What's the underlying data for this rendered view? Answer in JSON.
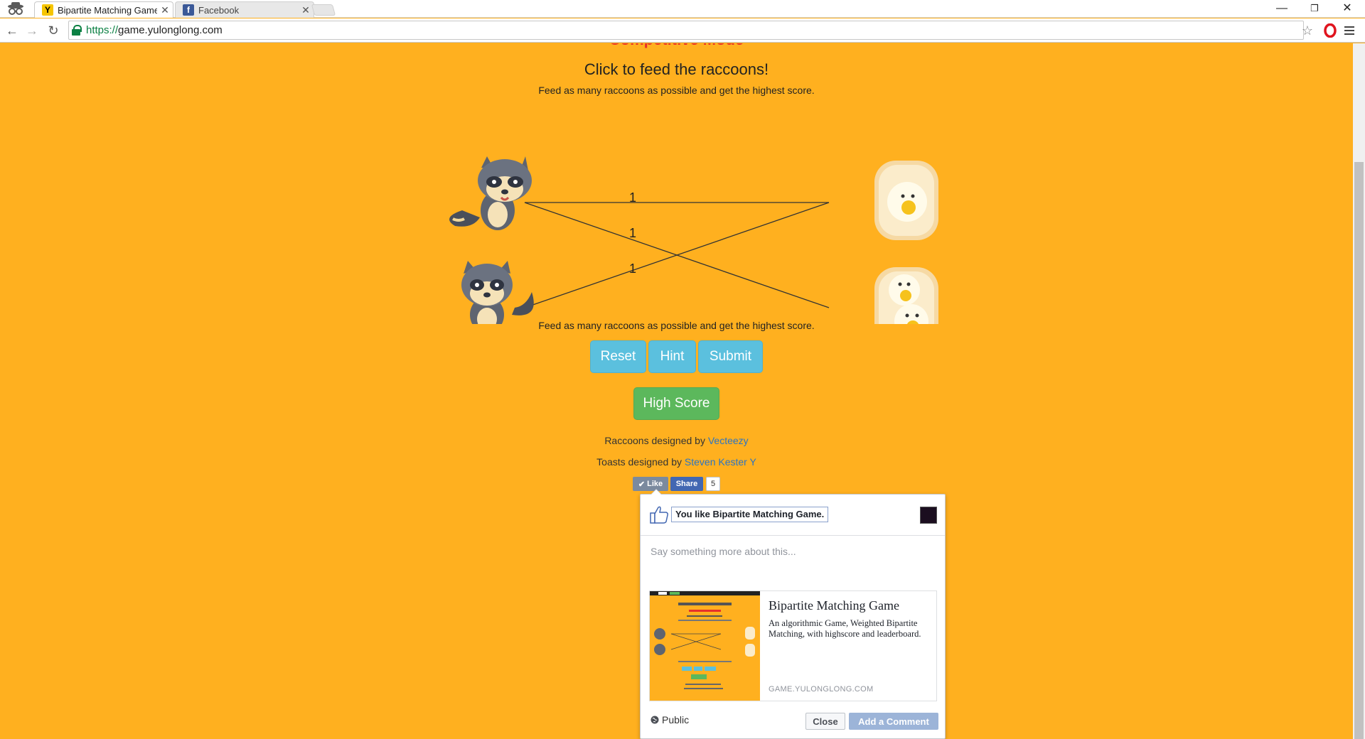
{
  "browser": {
    "tabs": [
      {
        "label": "Bipartite Matching Game",
        "favicon": "Y"
      },
      {
        "label": "Facebook",
        "favicon": "f"
      }
    ],
    "url_scheme": "https://",
    "url_host": "game.yulonglong.com",
    "window_controls": {
      "minimize": "—",
      "restore": "❐",
      "close": "✕"
    }
  },
  "page": {
    "mode_title": "Competitive Mode",
    "heading": "Click to feed the raccoons!",
    "subtitle": "Feed as many raccoons as possible and get the highest score.",
    "subtitle_bottom": "Feed as many raccoons as possible and get the highest score.",
    "edge_weights": [
      "1",
      "1",
      "1"
    ],
    "buttons": {
      "reset": "Reset",
      "hint": "Hint",
      "submit": "Submit",
      "high_score": "High Score"
    },
    "credits": {
      "raccoons_prefix": "Raccoons designed by ",
      "raccoons_link": "Vecteezy",
      "toasts_prefix": "Toasts designed by ",
      "toasts_link": "Steven Kester Y"
    },
    "colors": {
      "background": "#ffb01f",
      "mode_title": "#e8302a",
      "btn_info": "#5bc0de",
      "btn_success": "#5cb85c"
    }
  },
  "facebook": {
    "like_label": "Like",
    "share_label": "Share",
    "count": "5",
    "popup": {
      "you_like": "You like Bipartite Matching Game.",
      "comment_placeholder": "Say something more about this...",
      "card_title": "Bipartite Matching Game",
      "card_description": "An algorithmic Game, Weighted Bipartite Matching, with highscore and leaderboard.",
      "card_domain": "GAME.YULONGLONG.COM",
      "privacy": "Public",
      "close_label": "Close",
      "add_comment_label": "Add a Comment"
    }
  }
}
